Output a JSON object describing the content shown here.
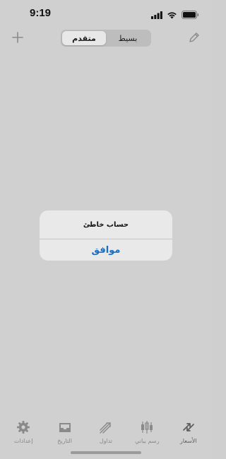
{
  "status_bar": {
    "time": "9:19"
  },
  "nav": {
    "segments": [
      "بسيط",
      "متقدم"
    ],
    "selected_segment": "متقدم",
    "add_icon": "plus-icon",
    "edit_icon": "pencil-icon"
  },
  "alert": {
    "message": "حساب خاطئ",
    "button_label": "موافق"
  },
  "tab_bar": {
    "tabs": [
      {
        "label": "إعدادات",
        "icon": "gear-icon"
      },
      {
        "label": "التاريخ",
        "icon": "inbox-tray-icon"
      },
      {
        "label": "تداول",
        "icon": "trade-arrows-icon"
      },
      {
        "label": "رسم بياني",
        "icon": "candlestick-icon"
      },
      {
        "label": "الأسعار",
        "icon": "quotes-arrows-icon"
      }
    ],
    "active_tab": "الأسعار"
  },
  "colors": {
    "accent": "#1a6fc4",
    "background": "#d0d0d0",
    "tab_inactive": "#888888"
  }
}
